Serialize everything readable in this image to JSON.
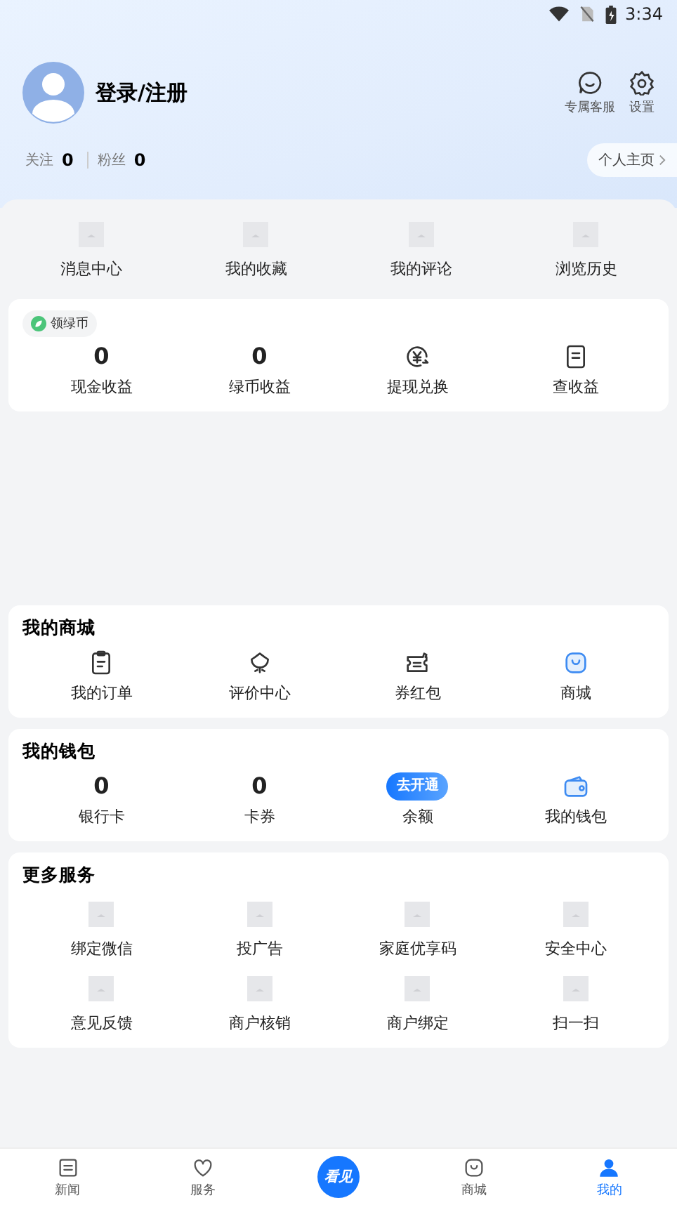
{
  "status_bar": {
    "time": "3:34"
  },
  "profile": {
    "name": "登录/注册",
    "actions": [
      {
        "label": "专属客服"
      },
      {
        "label": "设置"
      }
    ],
    "stats": [
      {
        "label": "关注",
        "value": "0"
      },
      {
        "label": "粉丝",
        "value": "0"
      }
    ],
    "homepage_link": "个人主页"
  },
  "quick_links": [
    {
      "label": "消息中心"
    },
    {
      "label": "我的收藏"
    },
    {
      "label": "我的评论"
    },
    {
      "label": "浏览历史"
    }
  ],
  "earnings": {
    "badge": "领绿币",
    "items": [
      {
        "kind": "value",
        "value": "0",
        "label": "现金收益"
      },
      {
        "kind": "value",
        "value": "0",
        "label": "绿币收益"
      },
      {
        "kind": "icon",
        "label": "提现兑换"
      },
      {
        "kind": "icon",
        "label": "查收益"
      }
    ]
  },
  "mall": {
    "title": "我的商城",
    "items": [
      {
        "label": "我的订单"
      },
      {
        "label": "评价中心"
      },
      {
        "label": "券红包"
      },
      {
        "label": "商城"
      }
    ]
  },
  "wallet": {
    "title": "我的钱包",
    "items": [
      {
        "kind": "value",
        "value": "0",
        "label": "银行卡"
      },
      {
        "kind": "value",
        "value": "0",
        "label": "卡券"
      },
      {
        "kind": "button",
        "button": "去开通",
        "label": "余额"
      },
      {
        "kind": "icon",
        "label": "我的钱包"
      }
    ]
  },
  "more_services": {
    "title": "更多服务",
    "items": [
      {
        "label": "绑定微信"
      },
      {
        "label": "投广告"
      },
      {
        "label": "家庭优享码"
      },
      {
        "label": "安全中心"
      },
      {
        "label": "意见反馈"
      },
      {
        "label": "商户核销"
      },
      {
        "label": "商户绑定"
      },
      {
        "label": "扫一扫"
      }
    ]
  },
  "tab_bar": [
    {
      "kind": "tab",
      "label": "新闻",
      "selected": false
    },
    {
      "kind": "tab",
      "label": "服务",
      "selected": false
    },
    {
      "kind": "logo",
      "label": "看见",
      "selected": false
    },
    {
      "kind": "tab",
      "label": "商城",
      "selected": false
    },
    {
      "kind": "tab",
      "label": "我的",
      "selected": true
    }
  ]
}
